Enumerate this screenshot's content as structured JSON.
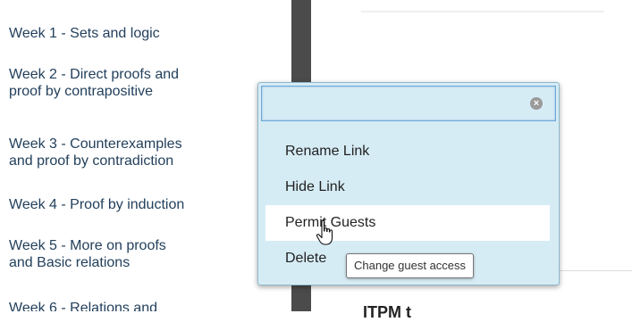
{
  "sidebar": {
    "weeks": [
      {
        "line1": "Week 1 - Sets and logic",
        "line2": ""
      },
      {
        "line1": "Week 2 - Direct proofs and",
        "line2": "proof by contrapositive"
      },
      {
        "line1": "Week 3 - Counterexamples",
        "line2": "and proof by contradiction"
      },
      {
        "line1": "Week 4 - Proof by induction",
        "line2": ""
      },
      {
        "line1": "Week 5 - More on proofs",
        "line2": "and Basic relations"
      },
      {
        "line1": "Week 6 - Relations and",
        "line2": ""
      }
    ]
  },
  "menu": {
    "search_value": "",
    "clear_glyph": "×",
    "items": [
      {
        "label": "Rename Link"
      },
      {
        "label": "Hide Link"
      },
      {
        "label": "Permit Guests"
      },
      {
        "label": "Delete"
      }
    ],
    "hovered_index": 2
  },
  "tooltip": {
    "text": "Change guest access"
  },
  "content": {
    "heading_partial": "ITPM t"
  },
  "colors": {
    "link": "#23405c",
    "menu_bg": "#d6ecf5",
    "divider": "#4b4b4b",
    "search_border": "#6aa7d8"
  },
  "icons": {
    "cursor": "hand-pointer-icon",
    "clear": "clear-circle-icon"
  }
}
